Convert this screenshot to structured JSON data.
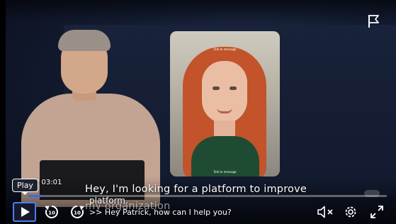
{
  "player": {
    "tooltip": "Play",
    "elapsed_time": "/ 03:01",
    "progress_fraction": 0.04,
    "rewind_seconds": "10",
    "forward_seconds": "10",
    "captions": {
      "line_1": "Hey, I'm looking for a platform to improve",
      "line_2": "my organization",
      "live_1": "platform.",
      "live_2": ">> Hey Patrick, how can I help you?"
    },
    "phone_card": {
      "tag": "Talk to message",
      "caption": "Talk to message"
    },
    "icons": {
      "play": "play-icon",
      "rewind": "rewind-10-icon",
      "forward": "forward-10-icon",
      "volume": "volume-muted-icon",
      "settings": "gear-icon",
      "fullscreen": "fullscreen-icon",
      "flag": "flag-icon"
    },
    "colors": {
      "accent": "#3a6de0",
      "focus_ring": "#4c7cf0"
    }
  }
}
